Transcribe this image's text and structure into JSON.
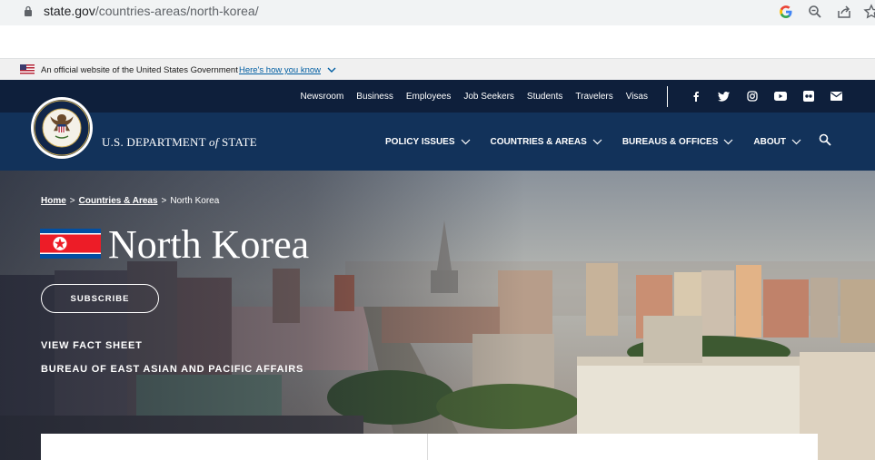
{
  "browser": {
    "url_host": "state.gov",
    "url_path": "/countries-areas/north-korea/",
    "icons": [
      "lock-icon",
      "google-icon",
      "zoom-icon",
      "share-icon",
      "bookmark-star-icon"
    ]
  },
  "official_banner": {
    "text": "An official website of the United States Government",
    "link": "Here's how you know"
  },
  "utility_nav": {
    "links": [
      "Newsroom",
      "Business",
      "Employees",
      "Job Seekers",
      "Students",
      "Travelers",
      "Visas"
    ],
    "social_icons": [
      "facebook-icon",
      "twitter-icon",
      "instagram-icon",
      "youtube-icon",
      "flickr-icon",
      "email-icon"
    ]
  },
  "header": {
    "dept_prefix": "U.S. DEPARTMENT ",
    "dept_of": "of",
    "dept_suffix": " STATE",
    "nav": [
      "POLICY ISSUES",
      "COUNTRIES & AREAS",
      "BUREAUS & OFFICES",
      "ABOUT"
    ]
  },
  "hero": {
    "breadcrumb": {
      "home": "Home",
      "sep": ">",
      "section": "Countries & Areas",
      "current": "North Korea"
    },
    "title": "North Korea",
    "subscribe": "SUBSCRIBE",
    "links": [
      "VIEW FACT SHEET",
      "BUREAU OF EAST ASIAN AND PACIFIC AFFAIRS"
    ]
  },
  "colors": {
    "utility_bg": "#0e1f3b",
    "nav_bg": "#12325a",
    "link_blue": "#005ea2"
  }
}
